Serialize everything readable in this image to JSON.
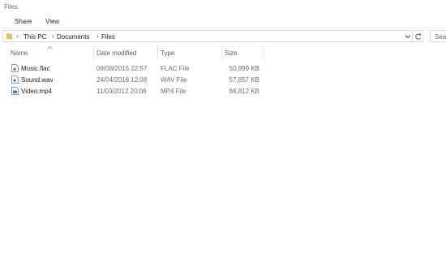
{
  "window": {
    "title": "Files"
  },
  "ribbon": {
    "tabs": [
      {
        "label": "Share"
      },
      {
        "label": "View"
      }
    ]
  },
  "address": {
    "crumbs": [
      {
        "label": "This PC"
      },
      {
        "label": "Documents"
      },
      {
        "label": "Files"
      }
    ]
  },
  "search": {
    "placeholder": "Search Files"
  },
  "columns": {
    "name": "Name",
    "date": "Date modified",
    "type": "Type",
    "size": "Size",
    "sorted_by": "Name"
  },
  "files": [
    {
      "name": "Music.flac",
      "date": "09/08/2015 22:57",
      "type": "FLAC File",
      "size": "50,999 KB",
      "icon": "audio-file-icon"
    },
    {
      "name": "Sound.wav",
      "date": "24/04/2016 12:08",
      "type": "WAV File",
      "size": "57,857 KB",
      "icon": "audio-file-icon"
    },
    {
      "name": "Video.mp4",
      "date": "11/03/2012 20:06",
      "type": "MP4 File",
      "size": "86,812 KB",
      "icon": "video-file-icon"
    }
  ],
  "colors": {
    "header_text": "#4c607a",
    "folder": "#e8c25b",
    "meta_text": "#6d6d6d"
  }
}
